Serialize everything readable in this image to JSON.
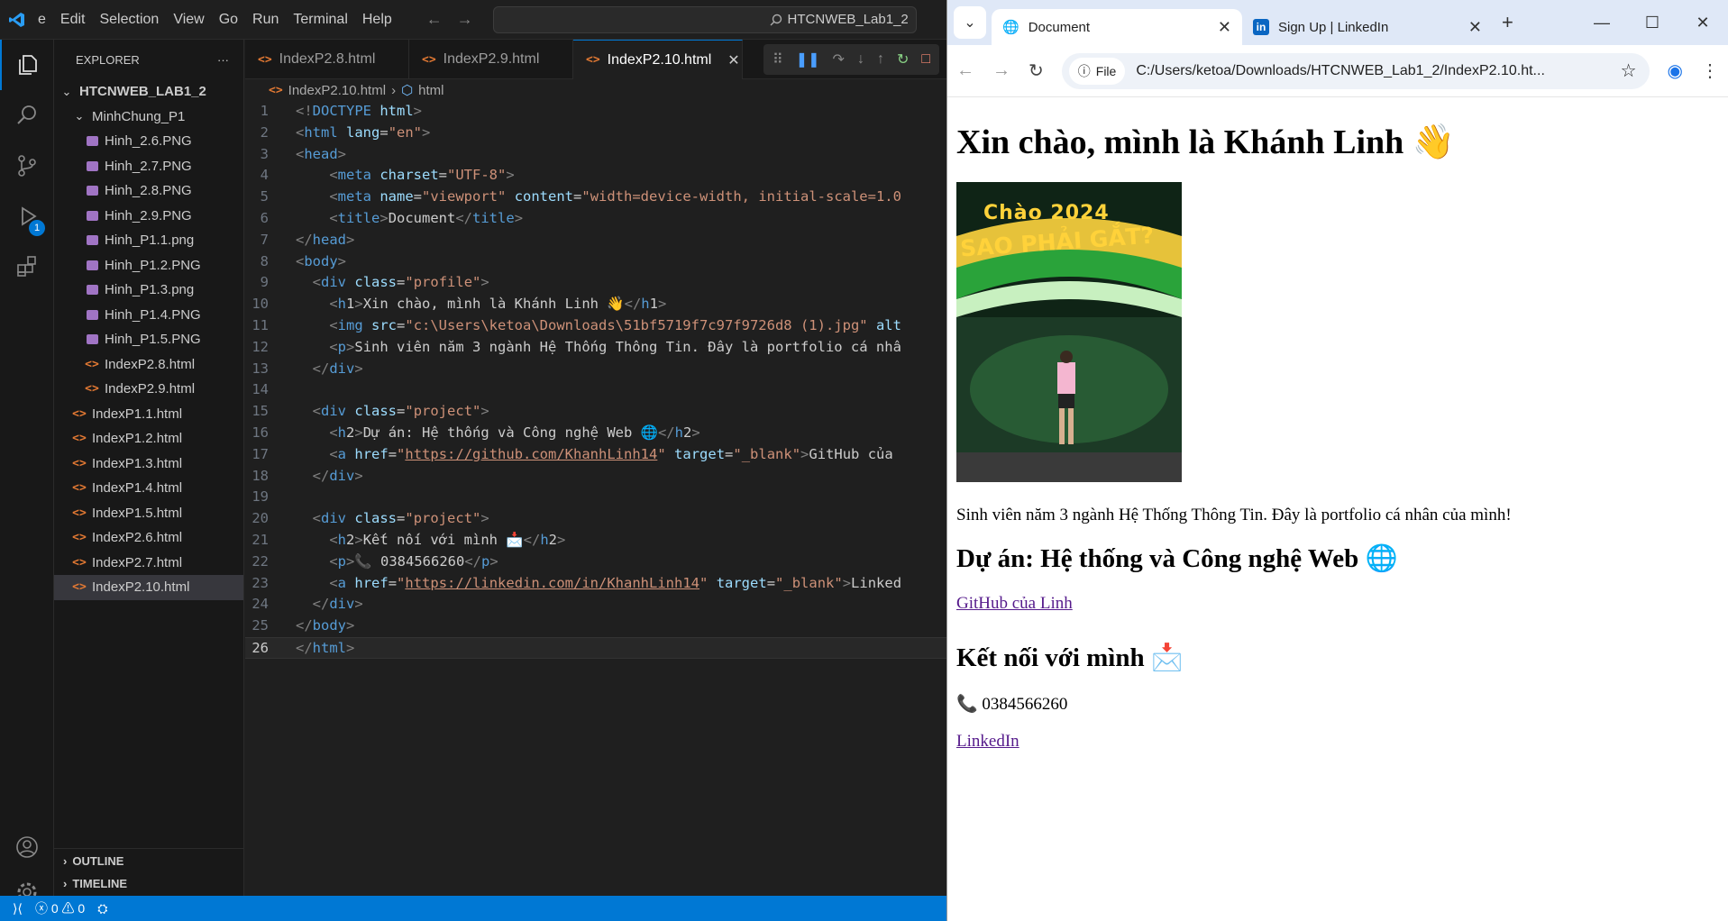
{
  "vscode": {
    "menu": [
      "e",
      "Edit",
      "Selection",
      "View",
      "Go",
      "Run",
      "Terminal",
      "Help"
    ],
    "command_center": "HTCNWEB_Lab1_2",
    "explorer": {
      "title": "EXPLORER",
      "project": "HTCNWEB_LAB1_2",
      "folder": "MinhChung_P1",
      "folder_items": [
        {
          "name": "Hinh_2.6.PNG",
          "type": "image"
        },
        {
          "name": "Hinh_2.7.PNG",
          "type": "image"
        },
        {
          "name": "Hinh_2.8.PNG",
          "type": "image"
        },
        {
          "name": "Hinh_2.9.PNG",
          "type": "image"
        },
        {
          "name": "Hinh_P1.1.png",
          "type": "image"
        },
        {
          "name": "Hinh_P1.2.PNG",
          "type": "image"
        },
        {
          "name": "Hinh_P1.3.png",
          "type": "image"
        },
        {
          "name": "Hinh_P1.4.PNG",
          "type": "image"
        },
        {
          "name": "Hinh_P1.5.PNG",
          "type": "image"
        },
        {
          "name": "IndexP2.8.html",
          "type": "html"
        },
        {
          "name": "IndexP2.9.html",
          "type": "html"
        }
      ],
      "root_items": [
        "IndexP1.1.html",
        "IndexP1.2.html",
        "IndexP1.3.html",
        "IndexP1.4.html",
        "IndexP1.5.html",
        "IndexP2.6.html",
        "IndexP2.7.html",
        "IndexP2.10.html"
      ],
      "selected": "IndexP2.10.html",
      "outline": "OUTLINE",
      "timeline": "TIMELINE"
    },
    "run_badge": "1",
    "tabs": [
      "IndexP2.8.html",
      "IndexP2.9.html",
      "IndexP2.10.html"
    ],
    "active_tab": "IndexP2.10.html",
    "breadcrumb": {
      "file": "IndexP2.10.html",
      "node": "html"
    },
    "code_lines": [
      "<!DOCTYPE html>",
      "<html lang=\"en\">",
      "<head>",
      "    <meta charset=\"UTF-8\">",
      "    <meta name=\"viewport\" content=\"width=device-width, initial-scale=1.0",
      "    <title>Document</title>",
      "</head>",
      "<body>",
      "  <div class=\"profile\">",
      "    <h1>Xin chào, mình là Khánh Linh 👋</h1>",
      "    <img src=\"c:\\Users\\ketoa\\Downloads\\51bf5719f7c97f9726d8 (1).jpg\" alt",
      "    <p>Sinh viên năm 3 ngành Hệ Thống Thông Tin. Đây là portfolio cá nhâ",
      "  </div>",
      "",
      "  <div class=\"project\">",
      "    <h2>Dự án: Hệ thống và Công nghệ Web 🌐</h2>",
      "    <a href=\"https://github.com/KhanhLinh14\" target=\"_blank\">GitHub của",
      "  </div>",
      "",
      "  <div class=\"project\">",
      "    <h2>Kết nối với mình 📩</h2>",
      "    <p>📞 0384566260</p>",
      "    <a href=\"https://linkedin.com/in/KhanhLinh14\" target=\"_blank\">Linked",
      "  </div>",
      "</body>",
      "</html>"
    ],
    "current_line": 26,
    "status": {
      "errors": "0",
      "warnings": "0"
    }
  },
  "chrome": {
    "tabs": [
      {
        "title": "Document",
        "active": true
      },
      {
        "title": "Sign Up | LinkedIn",
        "active": false
      }
    ],
    "url_chip": "File",
    "url": "C:/Users/ketoa/Downloads/HTCNWEB_Lab1_2/IndexP2.10.ht...",
    "page": {
      "h1": "Xin chào, mình là Khánh Linh 👋",
      "photo_text_1": "Chào 2024",
      "photo_text_2": "SAO PHẢI GẮT?",
      "intro": "Sinh viên năm 3 ngành Hệ Thống Thông Tin. Đây là portfolio cá nhân của mình!",
      "project_title": "Dự án: Hệ thống và Công nghệ Web 🌐",
      "github_link": "GitHub của Linh",
      "connect_title": "Kết nối với mình 📩",
      "phone": "📞 0384566260",
      "linkedin_link": "LinkedIn"
    }
  }
}
